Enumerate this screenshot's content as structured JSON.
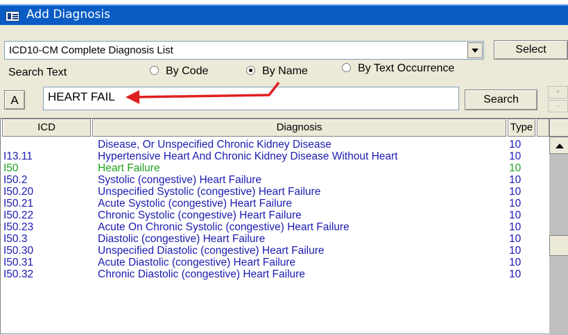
{
  "window": {
    "title": "Add Diagnosis"
  },
  "combo": {
    "value": "ICD10-CM Complete Diagnosis List"
  },
  "buttons": {
    "select_label": "Select",
    "search_label": "Search",
    "a_label": "A",
    "plus_label": "+",
    "minus_label": "-"
  },
  "search": {
    "label": "Search Text",
    "value": "HEART FAIL",
    "options": [
      {
        "label": "By Code",
        "checked": false
      },
      {
        "label": "By Name",
        "checked": true
      },
      {
        "label": "By Text Occurrence",
        "checked": false
      }
    ]
  },
  "table": {
    "columns": [
      "ICD",
      "Diagnosis",
      "Type"
    ],
    "rows": [
      {
        "code": "",
        "desc": "Disease, Or Unspecified Chronic Kidney Disease",
        "type": "10",
        "color": "#1a1ab0"
      },
      {
        "code": "I13.11",
        "desc": "Hypertensive Heart And Chronic Kidney Disease Without Heart",
        "type": "10",
        "color": "#1a1ab0"
      },
      {
        "code": "I50",
        "desc": "Heart Failure",
        "type": "10",
        "color": "#20a020"
      },
      {
        "code": "I50.2",
        "desc": "Systolic (congestive) Heart Failure",
        "type": "10",
        "color": "#1a1ab0"
      },
      {
        "code": "I50.20",
        "desc": "Unspecified Systolic (congestive) Heart Failure",
        "type": "10",
        "color": "#1a1ab0"
      },
      {
        "code": "I50.21",
        "desc": "Acute Systolic (congestive) Heart Failure",
        "type": "10",
        "color": "#1a1ab0"
      },
      {
        "code": "I50.22",
        "desc": "Chronic Systolic (congestive) Heart Failure",
        "type": "10",
        "color": "#1a1ab0"
      },
      {
        "code": "I50.23",
        "desc": "Acute On Chronic Systolic (congestive) Heart Failure",
        "type": "10",
        "color": "#1a1ab0"
      },
      {
        "code": "I50.3",
        "desc": "Diastolic (congestive) Heart Failure",
        "type": "10",
        "color": "#1a1ab0"
      },
      {
        "code": "I50.30",
        "desc": "Unspecified Diastolic (congestive) Heart Failure",
        "type": "10",
        "color": "#1a1ab0"
      },
      {
        "code": "I50.31",
        "desc": "Acute Diastolic (congestive) Heart Failure",
        "type": "10",
        "color": "#1a1ab0"
      },
      {
        "code": "I50.32",
        "desc": "Chronic Diastolic (congestive) Heart Failure",
        "type": "10",
        "color": "#1a1ab0"
      }
    ]
  },
  "colors": {
    "titlebar": "#0a5cc4",
    "row_default": "#1a1ab0",
    "row_highlight": "#20a020",
    "annotation": "#e02020"
  },
  "icons": [
    "window-app-icon",
    "dropdown-arrow-icon",
    "scroll-up-arrow-icon",
    "annotation-arrow-icon"
  ]
}
